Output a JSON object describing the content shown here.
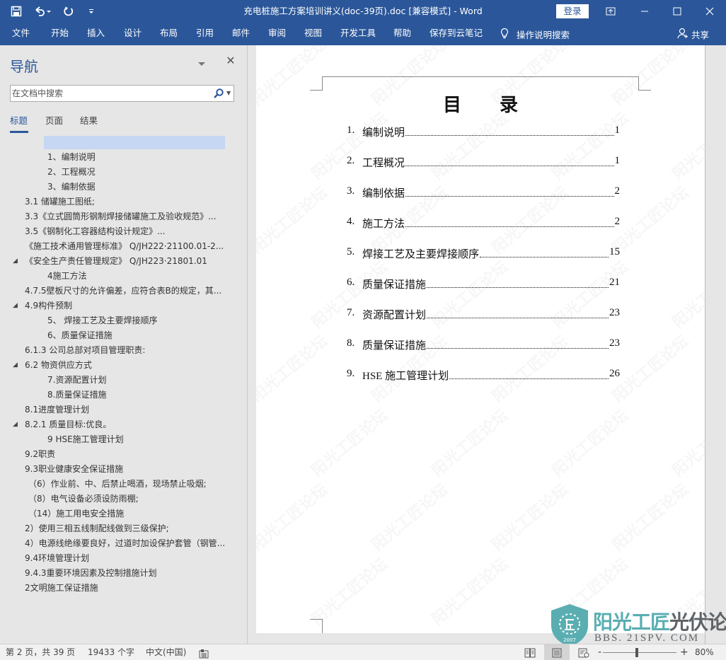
{
  "app": {
    "title": "充电桩施工方案培训讲义(doc-39页).doc [兼容模式]  -  Word",
    "login_label": "登录",
    "colors": {
      "accent": "#2b579a",
      "nav_selection": "#c5d7f2",
      "logo_teal": "#5aaeb1"
    }
  },
  "qat": {
    "icons": [
      "save-icon",
      "undo-icon",
      "redo-icon",
      "customize-qat-icon"
    ]
  },
  "window_controls": [
    "ribbon-display-options-icon",
    "minimize-icon",
    "maximize-icon",
    "close-icon"
  ],
  "ribbon": {
    "tabs": [
      "文件",
      "开始",
      "插入",
      "设计",
      "布局",
      "引用",
      "邮件",
      "审阅",
      "视图",
      "开发工具",
      "帮助",
      "保存到云笔记"
    ],
    "tell_me": "操作说明搜索",
    "share": "共享"
  },
  "nav": {
    "title": "导航",
    "search_placeholder": "在文档中搜索",
    "tabs": [
      "标题",
      "页面",
      "结果"
    ],
    "active_tab": "标题",
    "headings": [
      {
        "text": "1、编制说明",
        "level": 3,
        "collapsible": false
      },
      {
        "text": "2、工程概况",
        "level": 3,
        "collapsible": false
      },
      {
        "text": "3、编制依据",
        "level": 3,
        "collapsible": false
      },
      {
        "text": "3.1 储罐施工图纸;",
        "level": 1,
        "collapsible": false
      },
      {
        "text": "3.3《立式圆筒形钢制焊接储罐施工及验收规范》...",
        "level": 1,
        "collapsible": false
      },
      {
        "text": "3.5《钢制化工容器结构设计规定》...",
        "level": 1,
        "collapsible": false
      },
      {
        "text": "《施工技术通用管理标准》  Q/JH222·21100.01-2...",
        "level": 1,
        "collapsible": false
      },
      {
        "text": "《安全生产责任管理规定》    Q/JH223·21801.01",
        "level": 1,
        "collapsible": true
      },
      {
        "text": "4施工方法",
        "level": 3,
        "collapsible": false
      },
      {
        "text": "4.7.5壁板尺寸的允许偏差，应符合表B的规定，其...",
        "level": 1,
        "collapsible": false
      },
      {
        "text": "4.9构件预制",
        "level": 1,
        "collapsible": true
      },
      {
        "text": "5、 焊接工艺及主要焊接顺序",
        "level": 3,
        "collapsible": false
      },
      {
        "text": "6、质量保证措施",
        "level": 3,
        "collapsible": false
      },
      {
        "text": "6.1.3 公司总部对项目管理职责:",
        "level": 1,
        "collapsible": false
      },
      {
        "text": "6.2 物资供应方式",
        "level": 1,
        "collapsible": true
      },
      {
        "text": "7.资源配置计划",
        "level": 3,
        "collapsible": false
      },
      {
        "text": "8.质量保证措施",
        "level": 3,
        "collapsible": false
      },
      {
        "text": "8.1进度管理计划",
        "level": 1,
        "collapsible": false
      },
      {
        "text": "8.2.1 质量目标:优良。",
        "level": 1,
        "collapsible": true
      },
      {
        "text": "9 HSE施工管理计划",
        "level": 3,
        "collapsible": false
      },
      {
        "text": "9.2职责",
        "level": 1,
        "collapsible": false
      },
      {
        "text": "9.3职业健康安全保证措施",
        "level": 1,
        "collapsible": false
      },
      {
        "text": "（6）作业前、中、后禁止喝酒，现场禁止吸烟;",
        "level": 2,
        "collapsible": false
      },
      {
        "text": "（8）电气设备必须设防雨棚;",
        "level": 2,
        "collapsible": false
      },
      {
        "text": "（14）施工用电安全措施",
        "level": 2,
        "collapsible": false
      },
      {
        "text": "2）使用三相五线制配线做到三级保护;",
        "level": 1,
        "collapsible": false
      },
      {
        "text": "4）电源线绝缘要良好，过道时加设保护套管（钢管...",
        "level": 1,
        "collapsible": false
      },
      {
        "text": "9.4环境管理计划",
        "level": 1,
        "collapsible": false
      },
      {
        "text": "9.4.3重要环境因素及控制措施计划",
        "level": 1,
        "collapsible": false
      },
      {
        "text": "2文明施工保证措施",
        "level": 1,
        "collapsible": false
      }
    ]
  },
  "document": {
    "toc_title": "目录",
    "toc": [
      {
        "num": "1.",
        "label": "编制说明",
        "page": "1"
      },
      {
        "num": "2.",
        "label": "工程概况",
        "page": "1"
      },
      {
        "num": "3.",
        "label": "编制依据",
        "page": "2"
      },
      {
        "num": "4.",
        "label": "施工方法",
        "page": "2"
      },
      {
        "num": "5.",
        "label": "焊接工艺及主要焊接顺序",
        "page": "15"
      },
      {
        "num": "6.",
        "label": "质量保证措施",
        "page": "21"
      },
      {
        "num": "7.",
        "label": "资源配置计划",
        "page": "23"
      },
      {
        "num": "8.",
        "label": "质量保证措施",
        "page": "23"
      },
      {
        "num": "9.",
        "label": "HSE 施工管理计划",
        "page": "26"
      }
    ],
    "watermark_text": "阳光工匠论坛"
  },
  "logo": {
    "name_teal": "阳光工匠",
    "name_dark": "光伏论坛",
    "url": "BBS. 21SPV. COM",
    "year": "2007"
  },
  "status": {
    "page": "第 2 页，共 39 页",
    "words": "19433 个字",
    "language": "中文(中国)",
    "zoom": "80%",
    "zoom_minus": "-",
    "zoom_plus": "+"
  }
}
